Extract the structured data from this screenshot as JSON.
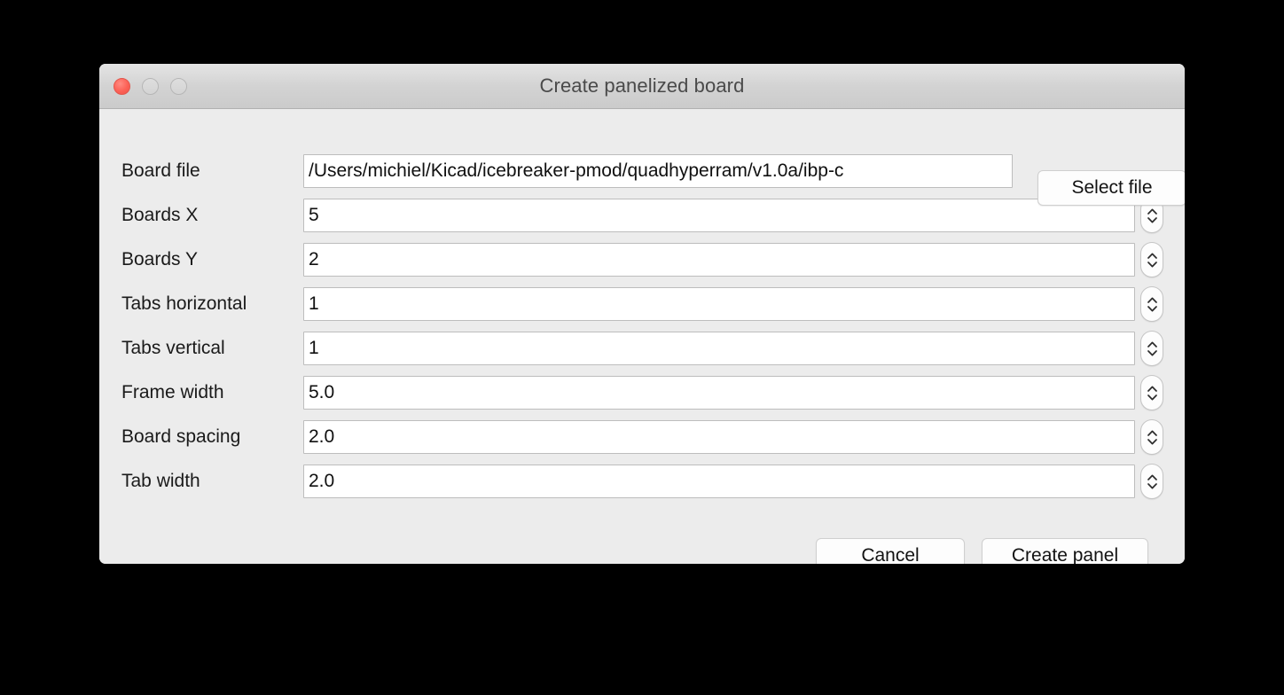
{
  "window": {
    "title": "Create panelized board",
    "traffic_lights": [
      {
        "name": "close",
        "color": "#fc6156"
      },
      {
        "name": "minimize",
        "color": "#d8d8d8"
      },
      {
        "name": "zoom",
        "color": "#d8d8d8"
      }
    ]
  },
  "form": {
    "rows": [
      {
        "label": "Board file",
        "value": "/Users/michiel/Kicad/icebreaker-pmod/quadhyperram/v1.0a/ibp-c",
        "type": "file"
      },
      {
        "label": "Boards X",
        "value": "5",
        "type": "number"
      },
      {
        "label": "Boards Y",
        "value": "2",
        "type": "number"
      },
      {
        "label": "Tabs horizontal",
        "value": "1",
        "type": "number"
      },
      {
        "label": "Tabs vertical",
        "value": "1",
        "type": "number"
      },
      {
        "label": "Frame width",
        "value": "5.0",
        "type": "number"
      },
      {
        "label": "Board spacing",
        "value": "2.0",
        "type": "number"
      },
      {
        "label": "Tab width",
        "value": "2.0",
        "type": "number"
      }
    ]
  },
  "buttons": {
    "select_file": "Select file",
    "cancel": "Cancel",
    "create_panel": "Create panel"
  },
  "icons": {
    "spinner_up": "chevron-up-icon",
    "spinner_down": "chevron-down-icon"
  },
  "colors": {
    "desktop_background": "#000000",
    "window_background": "#ececec",
    "titlebar_top": "#e4e4e4",
    "titlebar_bottom": "#cbcbcb",
    "field_background": "#ffffff",
    "field_border": "#bdbdbd",
    "text": "#1a1a1a",
    "title_text": "#4a4a4a"
  }
}
